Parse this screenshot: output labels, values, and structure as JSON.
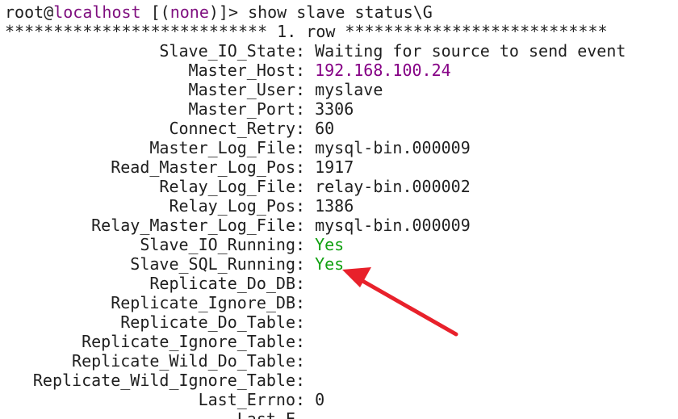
{
  "prompt": {
    "user": "root",
    "at": "@",
    "host": "localhost",
    "open": " [(",
    "db": "none",
    "close": ")]> ",
    "command": "show slave status\\G"
  },
  "row_header": "*************************** 1. row ***************************",
  "fields": [
    {
      "key": "Slave_IO_State",
      "value": "Waiting for source to send event"
    },
    {
      "key": "Master_Host",
      "value": "192.168.100.24",
      "style": "host"
    },
    {
      "key": "Master_User",
      "value": "myslave"
    },
    {
      "key": "Master_Port",
      "value": "3306"
    },
    {
      "key": "Connect_Retry",
      "value": "60"
    },
    {
      "key": "Master_Log_File",
      "value": "mysql-bin.000009"
    },
    {
      "key": "Read_Master_Log_Pos",
      "value": "1917"
    },
    {
      "key": "Relay_Log_File",
      "value": "relay-bin.000002"
    },
    {
      "key": "Relay_Log_Pos",
      "value": "1386"
    },
    {
      "key": "Relay_Master_Log_File",
      "value": "mysql-bin.000009"
    },
    {
      "key": "Slave_IO_Running",
      "value": "Yes",
      "style": "yes"
    },
    {
      "key": "Slave_SQL_Running",
      "value": "Yes",
      "style": "yes"
    },
    {
      "key": "Replicate_Do_DB",
      "value": ""
    },
    {
      "key": "Replicate_Ignore_DB",
      "value": ""
    },
    {
      "key": "Replicate_Do_Table",
      "value": ""
    },
    {
      "key": "Replicate_Ignore_Table",
      "value": ""
    },
    {
      "key": "Replicate_Wild_Do_Table",
      "value": ""
    },
    {
      "key": "Replicate_Wild_Ignore_Table",
      "value": ""
    },
    {
      "key": "Last_Errno",
      "value": "0"
    }
  ],
  "colors": {
    "text": "#1f1f1f",
    "host": "#850085",
    "yes": "#10a010",
    "arrow": "#e8212b",
    "background": "#ffffff"
  }
}
